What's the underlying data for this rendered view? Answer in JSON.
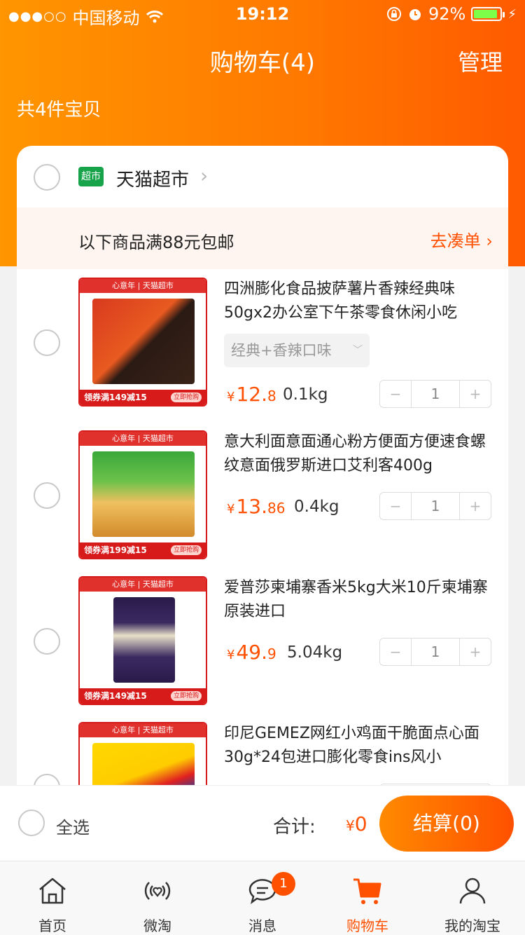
{
  "status": {
    "carrier": "中国移动",
    "time": "19:12",
    "battery": "92%"
  },
  "header": {
    "title": "购物车(4)",
    "manage": "管理",
    "items_count": "共4件宝贝"
  },
  "store": {
    "badge": "超市",
    "name": "天猫超市",
    "promo_text": "以下商品满88元包邮",
    "promo_link": "去凑单"
  },
  "items": [
    {
      "thumb_band": "心意年 | 天猫超市",
      "coupon": "领券满149减15",
      "coupon_go": "立即抢购",
      "title": "四洲膨化食品披萨薯片香辣经典味50gx2办公室下午茶零食休闲小吃",
      "sku": "经典+香辣口味",
      "price_yen": "¥",
      "price_int": "12.",
      "price_dec": "8",
      "weight": "0.1kg",
      "qty": "1",
      "minus": "−",
      "plus": "+"
    },
    {
      "thumb_band": "心意年 | 天猫超市",
      "coupon": "领券满199减15",
      "coupon_go": "立即抢购",
      "title": "意大利面意面通心粉方便面方便速食螺纹意面俄罗斯进口艾利客400g",
      "price_yen": "¥",
      "price_int": "13.",
      "price_dec": "86",
      "weight": "0.4kg",
      "qty": "1",
      "minus": "−",
      "plus": "+"
    },
    {
      "thumb_band": "心意年 | 天猫超市",
      "coupon": "领券满149减15",
      "coupon_go": "立即抢购",
      "title": "爱普莎柬埔寨香米5kg大米10斤柬埔寨原装进口",
      "price_yen": "¥",
      "price_int": "49.",
      "price_dec": "9",
      "weight": "5.04kg",
      "qty": "1",
      "minus": "−",
      "plus": "+"
    },
    {
      "thumb_band": "心意年 | 天猫超市",
      "title": "印尼GEMEZ网红小鸡面干脆面点心面30g*24包进口膨化零食ins风小"
    }
  ],
  "checkout": {
    "select_all": "全选",
    "total_label": "合计:",
    "total_yen": "¥",
    "total_value": "0",
    "button": "结算(0)"
  },
  "tabbar": {
    "badge": "1",
    "tabs": [
      {
        "label": "首页",
        "icon": "home-icon"
      },
      {
        "label": "微淘",
        "icon": "weitao-icon"
      },
      {
        "label": "消息",
        "icon": "message-icon"
      },
      {
        "label": "购物车",
        "icon": "cart-icon"
      },
      {
        "label": "我的淘宝",
        "icon": "profile-icon"
      }
    ]
  },
  "colors": {
    "accent": "#ff5000",
    "header_start": "#ff9500",
    "header_end": "#ff5a00"
  }
}
